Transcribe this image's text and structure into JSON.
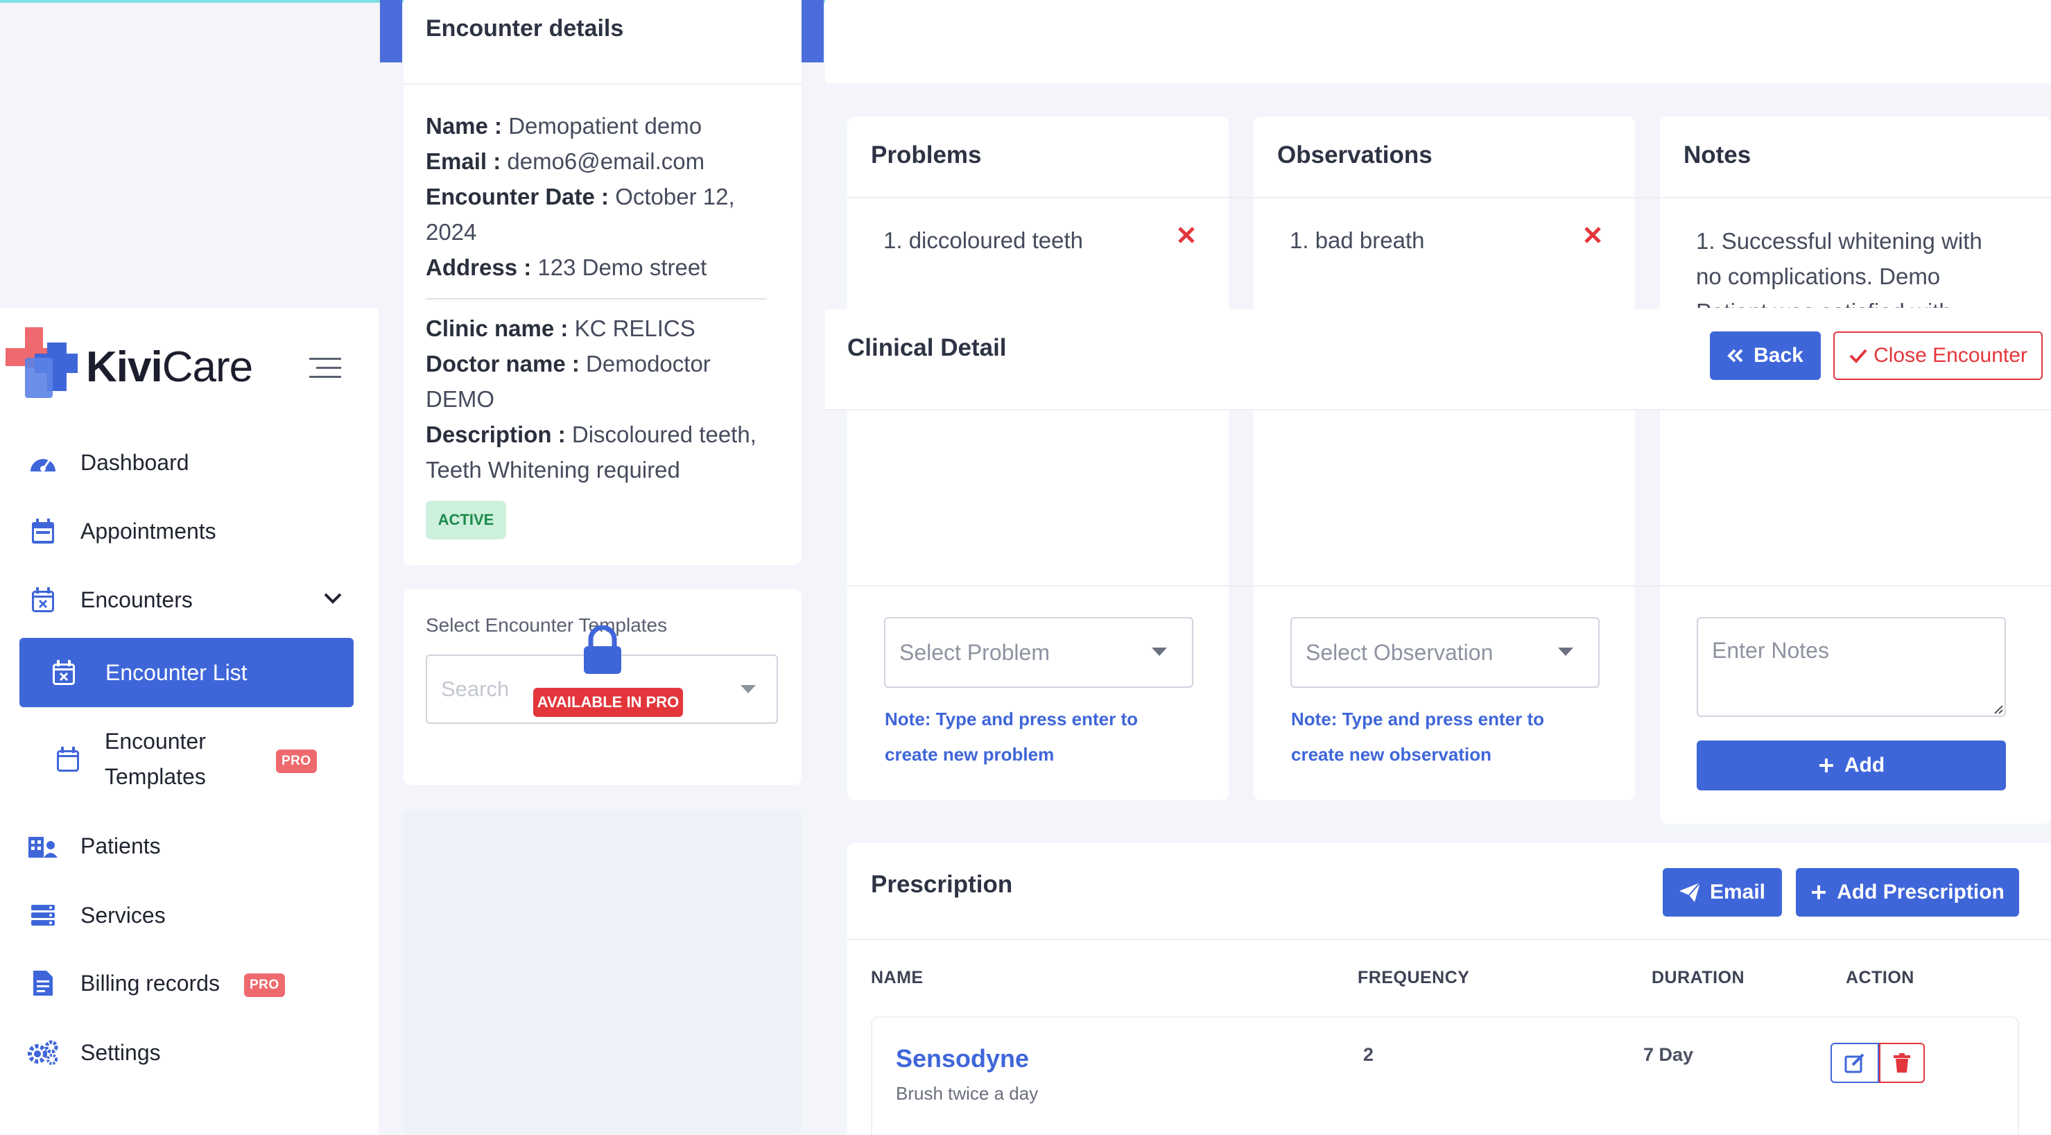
{
  "brand": {
    "name_bold": "Kivi",
    "name_light": "Care"
  },
  "sidebar": {
    "items": [
      {
        "label": "Dashboard",
        "icon": "dashboard-gauge-icon"
      },
      {
        "label": "Appointments",
        "icon": "calendar-icon"
      },
      {
        "label": "Encounters",
        "icon": "calendar-x-icon"
      },
      {
        "label": "Encounter List",
        "icon": "calendar-x-icon"
      },
      {
        "label_line1": "Encounter",
        "label_line2": "Templates",
        "icon": "calendar-icon",
        "badge": "PRO"
      },
      {
        "label": "Patients",
        "icon": "patients-icon"
      },
      {
        "label": "Services",
        "icon": "services-list-icon"
      },
      {
        "label": "Billing records",
        "icon": "billing-document-icon",
        "badge": "PRO"
      },
      {
        "label": "Settings",
        "icon": "gears-icon"
      }
    ]
  },
  "encounter": {
    "title": "Encounter details",
    "name_label": "Name :",
    "name": "Demopatient demo",
    "email_label": "Email :",
    "email": "demo6@email.com",
    "date_label": "Encounter Date :",
    "date_line1": "October 12,",
    "date_line2": "2024",
    "address_label": "Address :",
    "address": "123 Demo street",
    "clinic_label": "Clinic name :",
    "clinic": "KC RELICS",
    "doctor_label": "Doctor name :",
    "doctor_line1": "Demodoctor",
    "doctor_line2": "DEMO",
    "description_label": "Description :",
    "description_line1": "Discoloured teeth,",
    "description_line2": "Teeth Whitening required",
    "status": "ACTIVE"
  },
  "templates": {
    "label_part1": "Select Encounter ",
    "label_part2": "Templates",
    "search_placeholder": "Search",
    "pro_badge": "AVAILABLE IN PRO"
  },
  "problems": {
    "title": "Problems",
    "items": [
      "1. diccoloured teeth"
    ],
    "select_placeholder": "Select Problem",
    "note_line1": "Note: Type and press enter to",
    "note_line2": "create new problem"
  },
  "observations": {
    "title": "Observations",
    "items": [
      "1. bad breath"
    ],
    "select_placeholder": "Select Observation",
    "note_line1": "Note: Type and press enter to",
    "note_line2": "create new observation"
  },
  "notes": {
    "title": "Notes",
    "text_line1": "1. Successful whitening with",
    "text_line2": "no complications. Demo",
    "text_line3": "Patient was satisfied with",
    "placeholder": "Enter Notes",
    "add_label": "Add"
  },
  "clinical": {
    "title": "Clinical Detail",
    "back_label": "Back",
    "close_label": "Close Encounter"
  },
  "prescription": {
    "title": "Prescription",
    "email_label": "Email",
    "add_label": "Add Prescription",
    "columns": [
      "NAME",
      "FREQUENCY",
      "DURATION",
      "ACTION"
    ],
    "rows": [
      {
        "name": "Sensodyne",
        "instruction": "Brush twice a day",
        "frequency": "2",
        "duration": "7 Day"
      }
    ]
  },
  "colors": {
    "primary": "#3f66d9",
    "danger": "#e3363c",
    "success_bg": "#cdf0dc",
    "pro": "#ef6a6e"
  }
}
